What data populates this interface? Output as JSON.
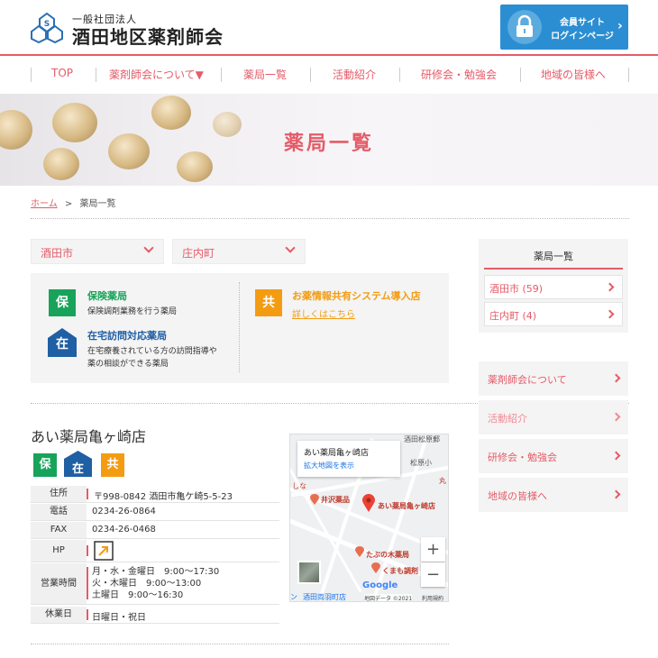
{
  "header": {
    "org_small": "一般社団法人",
    "org_name": "酒田地区薬剤師会",
    "member_line1": "会員サイト",
    "member_line2": "ログインページ",
    "lock_icon": "lock-icon"
  },
  "nav": {
    "items": [
      "TOP",
      "薬剤師会について▼",
      "薬局一覧",
      "活動紹介",
      "研修会・勉強会",
      "地域の皆様へ"
    ]
  },
  "banner": {
    "title": "薬局一覧"
  },
  "breadcrumb": {
    "home": "ホーム",
    "sep": ">",
    "current": "薬局一覧"
  },
  "filters": {
    "city": "酒田市",
    "town": "庄内町"
  },
  "legend": {
    "insurance": {
      "badge": "保",
      "title": "保険薬局",
      "desc": "保険調剤業務を行う薬局"
    },
    "home_visit": {
      "badge": "在",
      "title": "在宅訪問対応薬局",
      "desc1": "在宅療養されている方の訪問指導や",
      "desc2": "薬の相談ができる薬局"
    },
    "sharing": {
      "badge": "共",
      "title": "お薬情報共有システム導入店",
      "link": "詳しくはこちら"
    }
  },
  "pharmacy": {
    "name": "あい薬局亀ヶ崎店",
    "badges": [
      "保",
      "在",
      "共"
    ],
    "rows": {
      "address_label": "住所",
      "address": "〒998-0842 酒田市亀ケ崎5-5-23",
      "tel_label": "電話",
      "tel": "0234-26-0864",
      "fax_label": "FAX",
      "fax": "0234-26-0468",
      "hp_label": "HP",
      "hours_label": "営業時間",
      "hours": [
        "月・水・金曜日　9:00～17:30",
        "火・木曜日　9:00～13:00",
        "土曜日　9:00～16:30"
      ],
      "closed_label": "休業日",
      "closed": "日曜日・祝日"
    }
  },
  "map": {
    "card_name": "あい薬局亀ヶ崎店",
    "card_link": "拡大地図を表示",
    "pin_label": "あい薬局亀ヶ崎店",
    "places": [
      "井沢薬品",
      "たぶの木薬局",
      "くまも調剤"
    ],
    "top_text": "酒田松原郵",
    "school": "松原小",
    "maru": "丸",
    "shina": "しな",
    "station": "酒田両羽町店",
    "station_prefix": "ン",
    "google": "Google",
    "copyright": "地図データ ©2021",
    "terms": "利用規約",
    "zoom_in": "+",
    "zoom_out": "−"
  },
  "sidebar": {
    "title": "薬局一覧",
    "items": [
      "酒田市 (59)",
      "庄内町 (4)"
    ],
    "links": [
      "薬剤師会について",
      "活動紹介",
      "研修会・勉強会",
      "地域の皆様へ"
    ]
  },
  "colors": {
    "accent": "#e55b68",
    "blue": "#2b8ed3",
    "green": "#18a35a",
    "navy": "#1f5fa3",
    "orange": "#f39c12"
  }
}
